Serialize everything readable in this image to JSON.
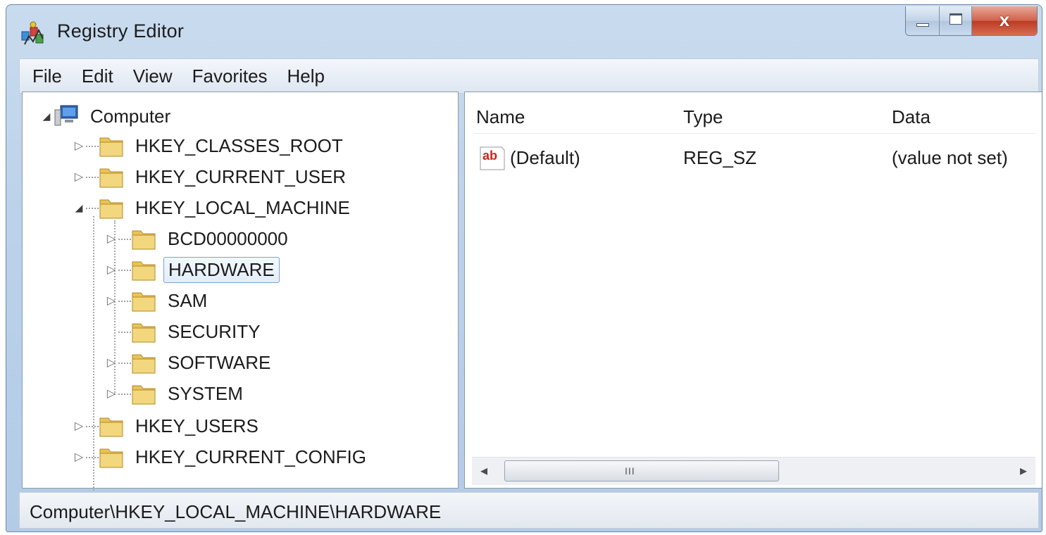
{
  "window": {
    "title": "Registry Editor",
    "close_glyph": "x"
  },
  "menu": {
    "items": [
      "File",
      "Edit",
      "View",
      "Favorites",
      "Help"
    ]
  },
  "tree": {
    "root": "Computer",
    "nodes": [
      {
        "label": "HKEY_CLASSES_ROOT",
        "expander": "▷"
      },
      {
        "label": "HKEY_CURRENT_USER",
        "expander": "▷"
      },
      {
        "label": "HKEY_LOCAL_MACHINE",
        "expander": "◢"
      },
      {
        "label": "BCD00000000",
        "expander": "▷"
      },
      {
        "label": "HARDWARE",
        "expander": "▷",
        "selected": true
      },
      {
        "label": "SAM",
        "expander": "▷"
      },
      {
        "label": "SECURITY",
        "expander": ""
      },
      {
        "label": "SOFTWARE",
        "expander": "▷"
      },
      {
        "label": "SYSTEM",
        "expander": "▷"
      },
      {
        "label": "HKEY_USERS",
        "expander": "▷"
      },
      {
        "label": "HKEY_CURRENT_CONFIG",
        "expander": "▷"
      }
    ],
    "root_expander": "◢"
  },
  "list": {
    "columns": [
      "Name",
      "Type",
      "Data"
    ],
    "rows": [
      {
        "name": "(Default)",
        "type": "REG_SZ",
        "data": "(value not set)",
        "icon": "string-value-icon",
        "icon_text": "ab"
      }
    ],
    "scroll_left": "◂",
    "scroll_right": "▸",
    "grip": "III"
  },
  "status": {
    "path": "Computer\\HKEY_LOCAL_MACHINE\\HARDWARE"
  },
  "colors": {
    "frame": "#bcd2ea",
    "close": "#c8462c",
    "selection_border": "#7da2ce",
    "folder": "#e8c35a"
  }
}
